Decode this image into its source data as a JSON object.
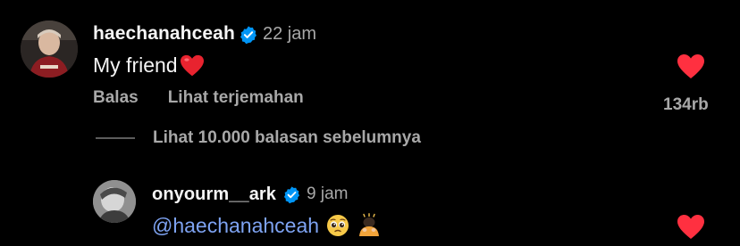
{
  "comments": [
    {
      "username": "haechanahceah",
      "time": "22 jam",
      "text": "My friend",
      "likes": "134rb",
      "actions": {
        "reply": "Balas",
        "translate": "Lihat terjemahan"
      }
    }
  ],
  "view_replies": "Lihat 10.000 balasan sebelumnya",
  "reply": {
    "username": "onyourm__ark",
    "time": "9 jam",
    "mention": "@haechanahceah"
  },
  "colors": {
    "background": "#000000",
    "heart": "#ff3040",
    "verified": "#0095f6",
    "mention": "#7ea3f2",
    "secondary_text": "#a8a8a8"
  },
  "icons": {
    "verified": "verified-badge-icon",
    "like": "heart-icon",
    "text_emoji": "red-heart-emoji",
    "reply_emojis": [
      "pleading-face-emoji",
      "bowing-person-emoji"
    ]
  }
}
